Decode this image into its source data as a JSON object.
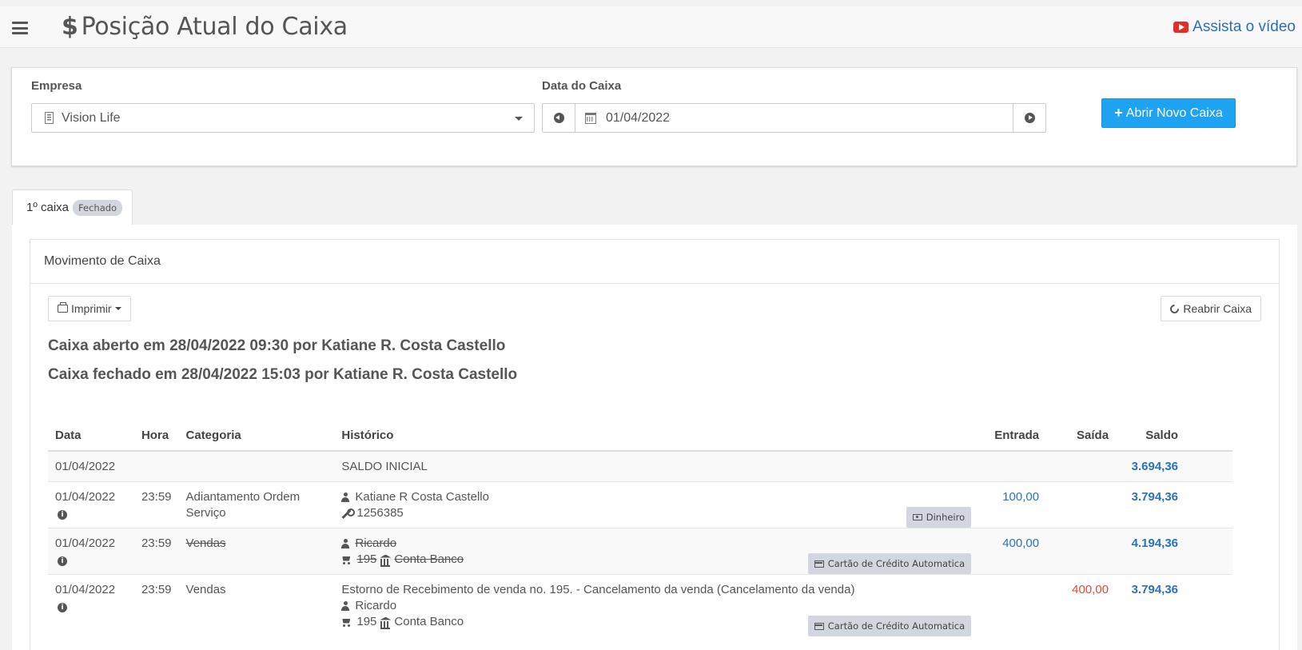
{
  "header": {
    "title": "Posição Atual do Caixa",
    "video_link": "Assista o vídeo"
  },
  "filters": {
    "empresa_label": "Empresa",
    "empresa_value": "Vision Life",
    "data_label": "Data do Caixa",
    "data_value": "01/04/2022",
    "open_button": "Abrir Novo Caixa"
  },
  "tabs": [
    {
      "label": "1º caixa",
      "badge": "Fechado"
    }
  ],
  "panel": {
    "title": "Movimento de Caixa",
    "print_button": "Imprimir",
    "reopen_button": "Reabrir Caixa",
    "opened_info": "Caixa aberto em 28/04/2022 09:30 por Katiane R. Costa Castello",
    "closed_info": "Caixa fechado em 28/04/2022 15:03 por Katiane R. Costa Castello"
  },
  "table": {
    "columns": [
      "Data",
      "Hora",
      "Categoria",
      "Histórico",
      "Entrada",
      "Saída",
      "Saldo"
    ],
    "rows": [
      {
        "data": "01/04/2022",
        "hora": "",
        "categoria": "",
        "historico": "SALDO INICIAL",
        "entrada": "",
        "saida": "",
        "saldo": "3.694,36"
      },
      {
        "data": "01/04/2022",
        "hora": "23:59",
        "categoria": "Adiantamento Ordem Serviço",
        "pessoa": "Katiane R Costa Castello",
        "ref": "1256385",
        "pagamento": "Dinheiro",
        "entrada": "100,00",
        "saida": "",
        "saldo": "3.794,36"
      },
      {
        "data": "01/04/2022",
        "hora": "23:59",
        "categoria": "Vendas",
        "pessoa": "Ricardo",
        "ref": "195",
        "conta": "Conta Banco",
        "pagamento": "Cartão de Crédito Automatica",
        "entrada": "400,00",
        "saida": "",
        "saldo": "4.194,36"
      },
      {
        "data": "01/04/2022",
        "hora": "23:59",
        "categoria": "Vendas",
        "historico": "Estorno de Recebimento de venda no. 195. - Cancelamento da venda (Cancelamento da venda)",
        "pessoa": "Ricardo",
        "ref": "195",
        "conta": "Conta Banco",
        "pagamento": "Cartão de Crédito Automatica",
        "entrada": "",
        "saida": "400,00",
        "saldo": "3.794,36"
      }
    ]
  }
}
